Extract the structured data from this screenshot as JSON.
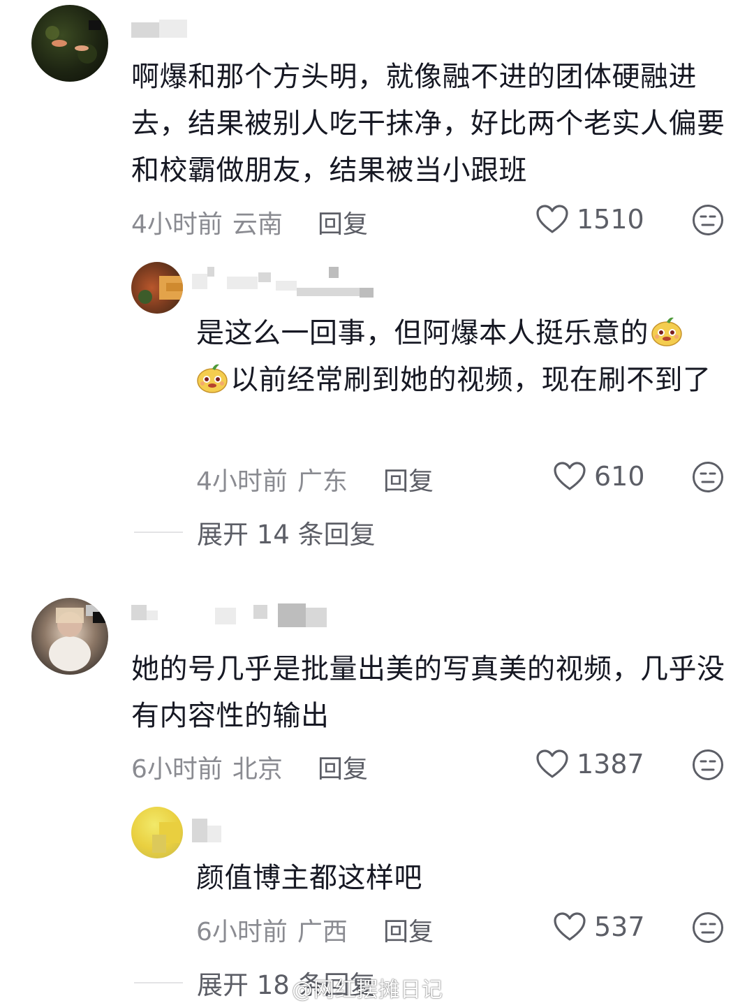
{
  "comments": [
    {
      "text": "啊爆和那个方头明，就像融不进的团体硬融进去，结果被别人吃干抹净，好比两个老实人偏要和校霸做朋友，结果被当小跟班",
      "time": "4小时前",
      "region": "云南",
      "reply_label": "回复",
      "likes": "1510",
      "replies": [
        {
          "text_a": "是这么一回事，但阿爆本人挺乐意的",
          "text_b": "以前经常刷到她的视频，现在刷不到了",
          "time": "4小时前",
          "region": "广东",
          "reply_label": "回复",
          "likes": "610"
        }
      ],
      "expand_label": "展开 14 条回复"
    },
    {
      "text": "她的号几乎是批量出美的写真美的视频，几乎没有内容性的输出",
      "time": "6小时前",
      "region": "北京",
      "reply_label": "回复",
      "likes": "1387",
      "replies": [
        {
          "text": "颜值博主都这样吧",
          "time": "6小时前",
          "region": "广西",
          "reply_label": "回复",
          "likes": "537"
        }
      ],
      "expand_label": "展开 18 条回复"
    }
  ],
  "watermark": "@网红摆摊日记",
  "icons": {
    "like": "heart-outline-icon",
    "dislike": "meh-face-icon",
    "emoji": "mango-sticker-emoji"
  }
}
